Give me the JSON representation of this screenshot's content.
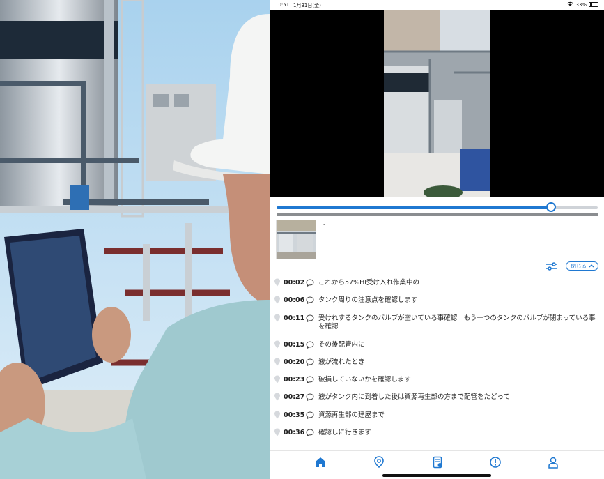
{
  "status_bar": {
    "time": "10:51",
    "date": "1月31日(金)",
    "battery": "33%",
    "battery_level": 0.33
  },
  "video": {
    "progress": 0.855
  },
  "clip": {
    "caption": "-"
  },
  "controls": {
    "close_label": "閉じる",
    "filter_icon": "sliders-icon",
    "chevron_icon": "chevron-up-icon"
  },
  "transcript": [
    {
      "time": "00:02",
      "text": "これから57%HI受け入れ作業中の"
    },
    {
      "time": "00:06",
      "text": "タンク周りの注意点を確認します"
    },
    {
      "time": "00:11",
      "text": "受けれするタンクのバルブが空いている事確認　もう一つのタンクのバルブが閉まっている事を確認"
    },
    {
      "time": "00:15",
      "text": "その後配管内に"
    },
    {
      "time": "00:20",
      "text": "液が流れたとき"
    },
    {
      "time": "00:23",
      "text": "破損していないかを確認します"
    },
    {
      "time": "00:27",
      "text": "液がタンク内に到着した後は資源再生部の方まで配管をたどって"
    },
    {
      "time": "00:35",
      "text": "資源再生部の建屋まで"
    },
    {
      "time": "00:36",
      "text": "確認しに行きます"
    }
  ],
  "nav": [
    {
      "icon": "home-icon",
      "active": true
    },
    {
      "icon": "location-pin-icon",
      "active": false
    },
    {
      "icon": "document-icon",
      "active": false
    },
    {
      "icon": "alert-icon",
      "active": false
    },
    {
      "icon": "user-icon",
      "active": false
    }
  ],
  "colors": {
    "accent": "#1f78d1",
    "text": "#222222",
    "video_bg": "#000000"
  }
}
